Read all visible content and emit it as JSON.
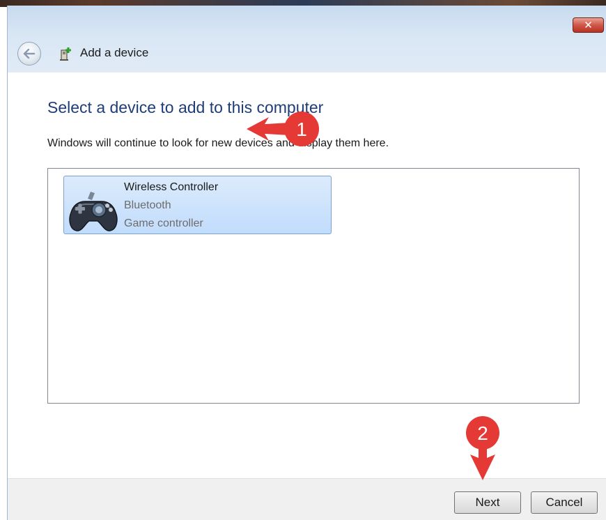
{
  "window": {
    "title": "Add a device",
    "close_symbol": "✕"
  },
  "main": {
    "heading": "Select a device to add to this computer",
    "instruction": "Windows will continue to look for new devices and display them here."
  },
  "devices": [
    {
      "name": "Wireless Controller",
      "connection": "Bluetooth",
      "category": "Game controller",
      "icon": "gamepad-icon",
      "selected": true
    }
  ],
  "annotations": {
    "step1": "1",
    "step2": "2",
    "color": "#e53935"
  },
  "buttons": {
    "next": "Next",
    "cancel": "Cancel"
  },
  "icons": {
    "back": "back-arrow-icon",
    "title": "device-add-icon",
    "close": "close-icon"
  }
}
